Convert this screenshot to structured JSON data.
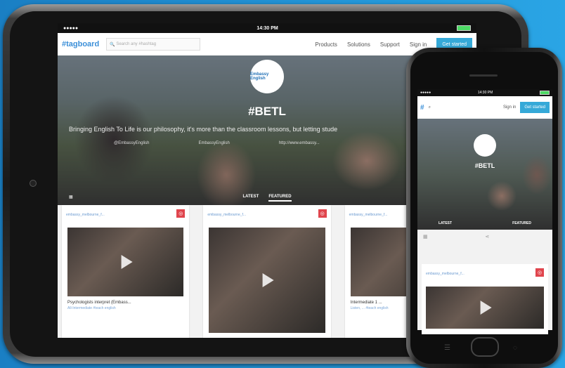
{
  "tablet": {
    "status": {
      "carrier": "●●●●●",
      "time": "14:30 PM"
    },
    "nav": {
      "logo": "#tagboard",
      "search_placeholder": "Search any #hashtag",
      "links": [
        "Products",
        "Solutions",
        "Support",
        "Sign in"
      ],
      "cta": "Get started"
    },
    "hero": {
      "badge": "Embassy English",
      "hashtag": "#BETL",
      "tagline": "Bringing English To Life is our philosophy, it's more than the classroom lessons, but letting stude",
      "socials": [
        "@EmbassyEnglish",
        "EmbassyEnglish",
        "http://www.embassy..."
      ],
      "tabs": [
        "LATEST",
        "FEATURED"
      ]
    },
    "cards": [
      {
        "user": "embassy_melbourne_f...",
        "title": "Psychologists interpret (Embass...",
        "subtitle": "All-Intermediate #teach english"
      },
      {
        "user": "embassy_melbourne_f...",
        "title": "",
        "subtitle": ""
      },
      {
        "user": "embassy_melbourne_f...",
        "title": "Intermediate 1 ...",
        "subtitle": "Listen, ... #teach english"
      }
    ]
  },
  "phone": {
    "status": {
      "carrier": "●●●●●",
      "time": "14:30 PM"
    },
    "nav": {
      "logo": "#",
      "signin": "Sign in",
      "cta": "Get started"
    },
    "hero": {
      "hashtag": "#BETL",
      "tabs": [
        "LATEST",
        "FEATURED"
      ]
    },
    "card": {
      "user": "embassy_melbourne_f..."
    }
  },
  "colors": {
    "accent": "#35a9d8",
    "link": "#3b8fd8",
    "instagram": "#e0454d",
    "background_blue": "#1a7fc4"
  }
}
